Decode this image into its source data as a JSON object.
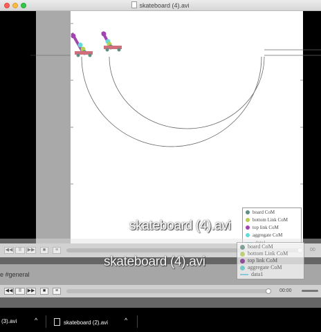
{
  "window": {
    "title": "skateboard (4).avi"
  },
  "overlay": {
    "title_large": "skateboard (4).avi",
    "title_small": "skateboard (4).avi",
    "time_a": "00",
    "time_b": "00:00",
    "play_label": "▶",
    "pause_label": "II",
    "rewind_label": "◀◀",
    "forward_label": "▶▶",
    "stop_label": "■",
    "list_label": "≡"
  },
  "chat": {
    "channel": "e #general"
  },
  "legend": {
    "items": [
      {
        "label": "board CoM",
        "color": "#5d8f84",
        "kind": "dot"
      },
      {
        "label": "bottom Link CoM",
        "color": "#b6cf50",
        "kind": "dot"
      },
      {
        "label": "top link CoM",
        "color": "#a044b0",
        "kind": "dot"
      },
      {
        "label": "aggregate CoM",
        "color": "#62dad8",
        "kind": "dot"
      },
      {
        "label": "data1",
        "color": "#7dd8ec",
        "kind": "line"
      }
    ]
  },
  "taskbar": {
    "items": [
      {
        "label": "(3).avi"
      },
      {
        "label": "skateboard (2).avi"
      }
    ],
    "caret": "^"
  }
}
